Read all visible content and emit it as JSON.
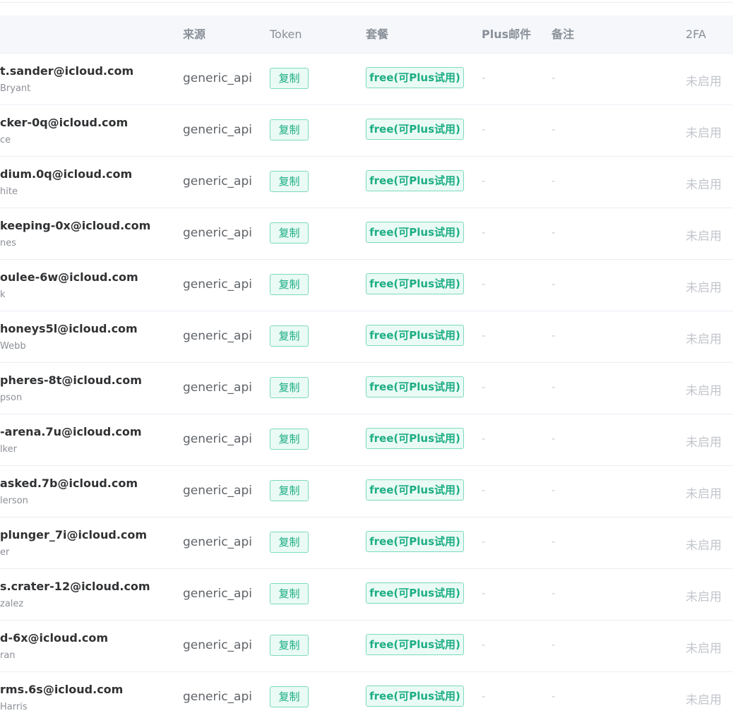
{
  "table": {
    "headers": {
      "source": "来源",
      "token": "Token",
      "plan": "套餐",
      "plus_email": "Plus邮件",
      "note": "备注",
      "twofa": "2FA"
    },
    "rows": [
      {
        "email": "t.sander@icloud.com",
        "name": "Bryant",
        "source": "generic_api",
        "token_action": "复制",
        "plan": "free(可Plus试用)",
        "plus_email": "-",
        "note": "-",
        "twofa": "未启用"
      },
      {
        "email": "cker-0q@icloud.com",
        "name": "ce",
        "source": "generic_api",
        "token_action": "复制",
        "plan": "free(可Plus试用)",
        "plus_email": "-",
        "note": "-",
        "twofa": "未启用"
      },
      {
        "email": "dium.0q@icloud.com",
        "name": "hite",
        "source": "generic_api",
        "token_action": "复制",
        "plan": "free(可Plus试用)",
        "plus_email": "-",
        "note": "-",
        "twofa": "未启用"
      },
      {
        "email": "keeping-0x@icloud.com",
        "name": "nes",
        "source": "generic_api",
        "token_action": "复制",
        "plan": "free(可Plus试用)",
        "plus_email": "-",
        "note": "-",
        "twofa": "未启用"
      },
      {
        "email": "oulee-6w@icloud.com",
        "name": "k",
        "source": "generic_api",
        "token_action": "复制",
        "plan": "free(可Plus试用)",
        "plus_email": "-",
        "note": "-",
        "twofa": "未启用"
      },
      {
        "email": "honeys5l@icloud.com",
        "name": "Webb",
        "source": "generic_api",
        "token_action": "复制",
        "plan": "free(可Plus试用)",
        "plus_email": "-",
        "note": "-",
        "twofa": "未启用"
      },
      {
        "email": "pheres-8t@icloud.com",
        "name": "pson",
        "source": "generic_api",
        "token_action": "复制",
        "plan": "free(可Plus试用)",
        "plus_email": "-",
        "note": "-",
        "twofa": "未启用"
      },
      {
        "email": "-arena.7u@icloud.com",
        "name": "lker",
        "source": "generic_api",
        "token_action": "复制",
        "plan": "free(可Plus试用)",
        "plus_email": "-",
        "note": "-",
        "twofa": "未启用"
      },
      {
        "email": "asked.7b@icloud.com",
        "name": "lerson",
        "source": "generic_api",
        "token_action": "复制",
        "plan": "free(可Plus试用)",
        "plus_email": "-",
        "note": "-",
        "twofa": "未启用"
      },
      {
        "email": "plunger_7i@icloud.com",
        "name": "er",
        "source": "generic_api",
        "token_action": "复制",
        "plan": "free(可Plus试用)",
        "plus_email": "-",
        "note": "-",
        "twofa": "未启用"
      },
      {
        "email": "s.crater-12@icloud.com",
        "name": "zalez",
        "source": "generic_api",
        "token_action": "复制",
        "plan": "free(可Plus试用)",
        "plus_email": "-",
        "note": "-",
        "twofa": "未启用"
      },
      {
        "email": "d-6x@icloud.com",
        "name": "ran",
        "source": "generic_api",
        "token_action": "复制",
        "plan": "free(可Plus试用)",
        "plus_email": "-",
        "note": "-",
        "twofa": "未启用"
      },
      {
        "email": "rms.6s@icloud.com",
        "name": "Harris",
        "source": "generic_api",
        "token_action": "复制",
        "plan": "free(可Plus试用)",
        "plus_email": "-",
        "note": "-",
        "twofa": "未启用"
      }
    ]
  }
}
